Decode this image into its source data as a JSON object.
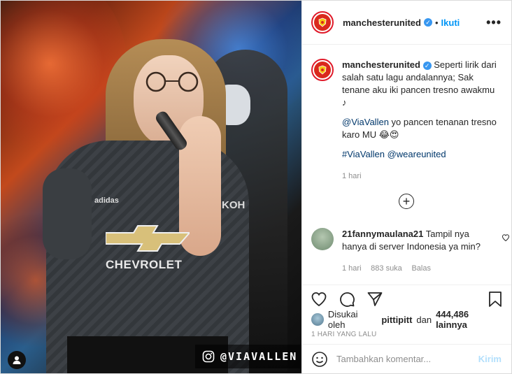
{
  "post": {
    "photo": {
      "jersey_sponsor": "CHEVROLET",
      "jersey_brand": "adidas",
      "jersey_side_sponsor": "KOH",
      "watermark_handle": "@VIAVALLEN"
    },
    "header": {
      "username": "manchesterunited",
      "follow_label": "Ikuti",
      "more_icon": "more-horizontal-icon"
    },
    "caption": {
      "username": "manchesterunited",
      "text_line1": "Seperti lirik dari salah satu lagu andalannya; Sak tenane aku iki pancen tresno awakmu ♪",
      "mention": "@ViaVallen",
      "text_line2": " yo pancen tenanan tresno karo MU 😂😍",
      "hashtag1": "#ViaVallen",
      "hashtag2": "@weareunited",
      "time": "1 hari"
    },
    "comments": [
      {
        "username": "21fannymaulana21",
        "text": "Tampil nya hanya di server Indonesia ya min?",
        "time": "1 hari",
        "likes": "883 suka",
        "reply_label": "Balas"
      }
    ],
    "likes": {
      "prefix": "Disukai oleh",
      "liker": "pittipitt",
      "conj": "dan",
      "count": "444,486 lainnya"
    },
    "timestamp": "1 HARI YANG LALU",
    "add_comment": {
      "placeholder": "Tambahkan komentar...",
      "post_label": "Kirim"
    }
  }
}
